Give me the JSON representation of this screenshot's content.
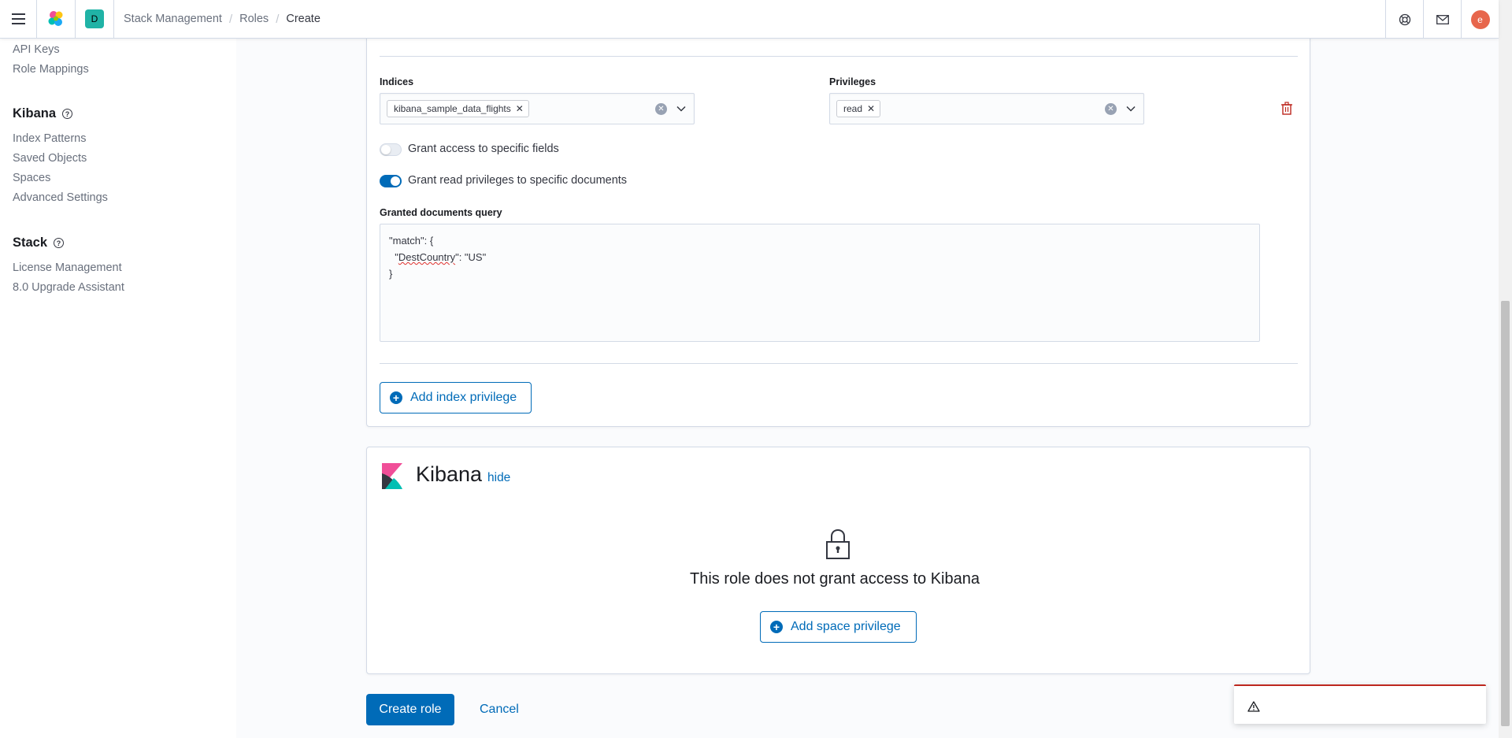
{
  "header": {
    "space_initial": "D",
    "breadcrumbs": [
      "Stack Management",
      "Roles",
      "Create"
    ],
    "user_initial": "e"
  },
  "sidebar": {
    "security_items": [
      "API Keys",
      "Role Mappings"
    ],
    "kibana_section": "Kibana",
    "kibana_items": [
      "Index Patterns",
      "Saved Objects",
      "Spaces",
      "Advanced Settings"
    ],
    "stack_section": "Stack",
    "stack_items": [
      "License Management",
      "8.0 Upgrade Assistant"
    ]
  },
  "index_privileges": {
    "indices_label": "Indices",
    "indices_value": "kibana_sample_data_flights",
    "privileges_label": "Privileges",
    "privileges_value": "read",
    "field_access_label": "Grant access to specific fields",
    "field_access_enabled": false,
    "doc_privileges_label": "Grant read privileges to specific documents",
    "doc_privileges_enabled": true,
    "query_label": "Granted documents query",
    "query_line1": "\"match\": {",
    "query_line2_pre": "  \"",
    "query_line2_word": "DestCountry",
    "query_line2_post": "\": \"US\"",
    "query_line3": "}",
    "add_button": "Add index privilege"
  },
  "kibana_panel": {
    "title": "Kibana",
    "hide_link": "hide",
    "empty_message": "This role does not grant access to Kibana",
    "add_button": "Add space privilege"
  },
  "footer": {
    "create_button": "Create role",
    "cancel_button": "Cancel"
  },
  "colors": {
    "primary": "#006bb8",
    "danger": "#bd271e",
    "space_badge": "#20b3a6",
    "avatar": "#e7664c"
  }
}
